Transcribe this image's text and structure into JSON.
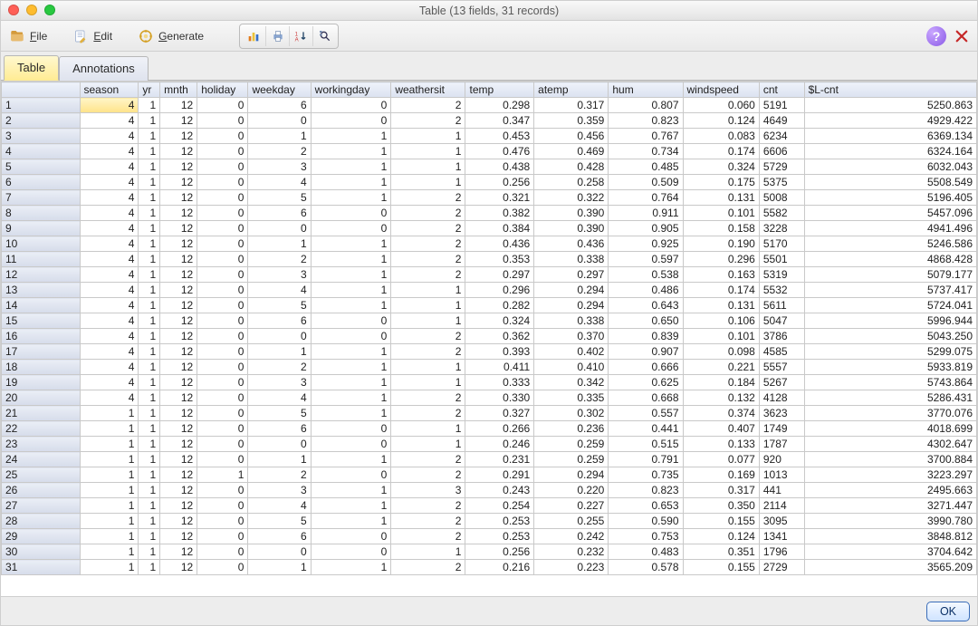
{
  "window": {
    "title": "Table (13 fields, 31 records)"
  },
  "menus": {
    "file": {
      "label_pre": "",
      "label_u": "F",
      "label_post": "ile"
    },
    "edit": {
      "label_pre": "",
      "label_u": "E",
      "label_post": "dit"
    },
    "generate": {
      "label_pre": "",
      "label_u": "G",
      "label_post": "enerate"
    }
  },
  "tabs": {
    "table": "Table",
    "annotations": "Annotations"
  },
  "columns": [
    "season",
    "yr",
    "mnth",
    "holiday",
    "weekday",
    "workingday",
    "weathersit",
    "temp",
    "atemp",
    "hum",
    "windspeed",
    "cnt",
    "$L-cnt"
  ],
  "column_align": [
    "num",
    "num",
    "num",
    "num",
    "num",
    "num",
    "num",
    "num",
    "num",
    "num",
    "num",
    "txt",
    "num"
  ],
  "rows": [
    {
      "n": "1",
      "v": [
        "4",
        "1",
        "12",
        "0",
        "6",
        "0",
        "2",
        "0.298",
        "0.317",
        "0.807",
        "0.060",
        "5191",
        "5250.863"
      ]
    },
    {
      "n": "2",
      "v": [
        "4",
        "1",
        "12",
        "0",
        "0",
        "0",
        "2",
        "0.347",
        "0.359",
        "0.823",
        "0.124",
        "4649",
        "4929.422"
      ]
    },
    {
      "n": "3",
      "v": [
        "4",
        "1",
        "12",
        "0",
        "1",
        "1",
        "1",
        "0.453",
        "0.456",
        "0.767",
        "0.083",
        "6234",
        "6369.134"
      ]
    },
    {
      "n": "4",
      "v": [
        "4",
        "1",
        "12",
        "0",
        "2",
        "1",
        "1",
        "0.476",
        "0.469",
        "0.734",
        "0.174",
        "6606",
        "6324.164"
      ]
    },
    {
      "n": "5",
      "v": [
        "4",
        "1",
        "12",
        "0",
        "3",
        "1",
        "1",
        "0.438",
        "0.428",
        "0.485",
        "0.324",
        "5729",
        "6032.043"
      ]
    },
    {
      "n": "6",
      "v": [
        "4",
        "1",
        "12",
        "0",
        "4",
        "1",
        "1",
        "0.256",
        "0.258",
        "0.509",
        "0.175",
        "5375",
        "5508.549"
      ]
    },
    {
      "n": "7",
      "v": [
        "4",
        "1",
        "12",
        "0",
        "5",
        "1",
        "2",
        "0.321",
        "0.322",
        "0.764",
        "0.131",
        "5008",
        "5196.405"
      ]
    },
    {
      "n": "8",
      "v": [
        "4",
        "1",
        "12",
        "0",
        "6",
        "0",
        "2",
        "0.382",
        "0.390",
        "0.911",
        "0.101",
        "5582",
        "5457.096"
      ]
    },
    {
      "n": "9",
      "v": [
        "4",
        "1",
        "12",
        "0",
        "0",
        "0",
        "2",
        "0.384",
        "0.390",
        "0.905",
        "0.158",
        "3228",
        "4941.496"
      ]
    },
    {
      "n": "10",
      "v": [
        "4",
        "1",
        "12",
        "0",
        "1",
        "1",
        "2",
        "0.436",
        "0.436",
        "0.925",
        "0.190",
        "5170",
        "5246.586"
      ]
    },
    {
      "n": "11",
      "v": [
        "4",
        "1",
        "12",
        "0",
        "2",
        "1",
        "2",
        "0.353",
        "0.338",
        "0.597",
        "0.296",
        "5501",
        "4868.428"
      ]
    },
    {
      "n": "12",
      "v": [
        "4",
        "1",
        "12",
        "0",
        "3",
        "1",
        "2",
        "0.297",
        "0.297",
        "0.538",
        "0.163",
        "5319",
        "5079.177"
      ]
    },
    {
      "n": "13",
      "v": [
        "4",
        "1",
        "12",
        "0",
        "4",
        "1",
        "1",
        "0.296",
        "0.294",
        "0.486",
        "0.174",
        "5532",
        "5737.417"
      ]
    },
    {
      "n": "14",
      "v": [
        "4",
        "1",
        "12",
        "0",
        "5",
        "1",
        "1",
        "0.282",
        "0.294",
        "0.643",
        "0.131",
        "5611",
        "5724.041"
      ]
    },
    {
      "n": "15",
      "v": [
        "4",
        "1",
        "12",
        "0",
        "6",
        "0",
        "1",
        "0.324",
        "0.338",
        "0.650",
        "0.106",
        "5047",
        "5996.944"
      ]
    },
    {
      "n": "16",
      "v": [
        "4",
        "1",
        "12",
        "0",
        "0",
        "0",
        "2",
        "0.362",
        "0.370",
        "0.839",
        "0.101",
        "3786",
        "5043.250"
      ]
    },
    {
      "n": "17",
      "v": [
        "4",
        "1",
        "12",
        "0",
        "1",
        "1",
        "2",
        "0.393",
        "0.402",
        "0.907",
        "0.098",
        "4585",
        "5299.075"
      ]
    },
    {
      "n": "18",
      "v": [
        "4",
        "1",
        "12",
        "0",
        "2",
        "1",
        "1",
        "0.411",
        "0.410",
        "0.666",
        "0.221",
        "5557",
        "5933.819"
      ]
    },
    {
      "n": "19",
      "v": [
        "4",
        "1",
        "12",
        "0",
        "3",
        "1",
        "1",
        "0.333",
        "0.342",
        "0.625",
        "0.184",
        "5267",
        "5743.864"
      ]
    },
    {
      "n": "20",
      "v": [
        "4",
        "1",
        "12",
        "0",
        "4",
        "1",
        "2",
        "0.330",
        "0.335",
        "0.668",
        "0.132",
        "4128",
        "5286.431"
      ]
    },
    {
      "n": "21",
      "v": [
        "1",
        "1",
        "12",
        "0",
        "5",
        "1",
        "2",
        "0.327",
        "0.302",
        "0.557",
        "0.374",
        "3623",
        "3770.076"
      ]
    },
    {
      "n": "22",
      "v": [
        "1",
        "1",
        "12",
        "0",
        "6",
        "0",
        "1",
        "0.266",
        "0.236",
        "0.441",
        "0.407",
        "1749",
        "4018.699"
      ]
    },
    {
      "n": "23",
      "v": [
        "1",
        "1",
        "12",
        "0",
        "0",
        "0",
        "1",
        "0.246",
        "0.259",
        "0.515",
        "0.133",
        "1787",
        "4302.647"
      ]
    },
    {
      "n": "24",
      "v": [
        "1",
        "1",
        "12",
        "0",
        "1",
        "1",
        "2",
        "0.231",
        "0.259",
        "0.791",
        "0.077",
        "920",
        "3700.884"
      ]
    },
    {
      "n": "25",
      "v": [
        "1",
        "1",
        "12",
        "1",
        "2",
        "0",
        "2",
        "0.291",
        "0.294",
        "0.735",
        "0.169",
        "1013",
        "3223.297"
      ]
    },
    {
      "n": "26",
      "v": [
        "1",
        "1",
        "12",
        "0",
        "3",
        "1",
        "3",
        "0.243",
        "0.220",
        "0.823",
        "0.317",
        "441",
        "2495.663"
      ]
    },
    {
      "n": "27",
      "v": [
        "1",
        "1",
        "12",
        "0",
        "4",
        "1",
        "2",
        "0.254",
        "0.227",
        "0.653",
        "0.350",
        "2114",
        "3271.447"
      ]
    },
    {
      "n": "28",
      "v": [
        "1",
        "1",
        "12",
        "0",
        "5",
        "1",
        "2",
        "0.253",
        "0.255",
        "0.590",
        "0.155",
        "3095",
        "3990.780"
      ]
    },
    {
      "n": "29",
      "v": [
        "1",
        "1",
        "12",
        "0",
        "6",
        "0",
        "2",
        "0.253",
        "0.242",
        "0.753",
        "0.124",
        "1341",
        "3848.812"
      ]
    },
    {
      "n": "30",
      "v": [
        "1",
        "1",
        "12",
        "0",
        "0",
        "0",
        "1",
        "0.256",
        "0.232",
        "0.483",
        "0.351",
        "1796",
        "3704.642"
      ]
    },
    {
      "n": "31",
      "v": [
        "1",
        "1",
        "12",
        "0",
        "1",
        "1",
        "2",
        "0.216",
        "0.223",
        "0.578",
        "0.155",
        "2729",
        "3565.209"
      ]
    }
  ],
  "footer": {
    "ok": "OK"
  },
  "help": "?"
}
